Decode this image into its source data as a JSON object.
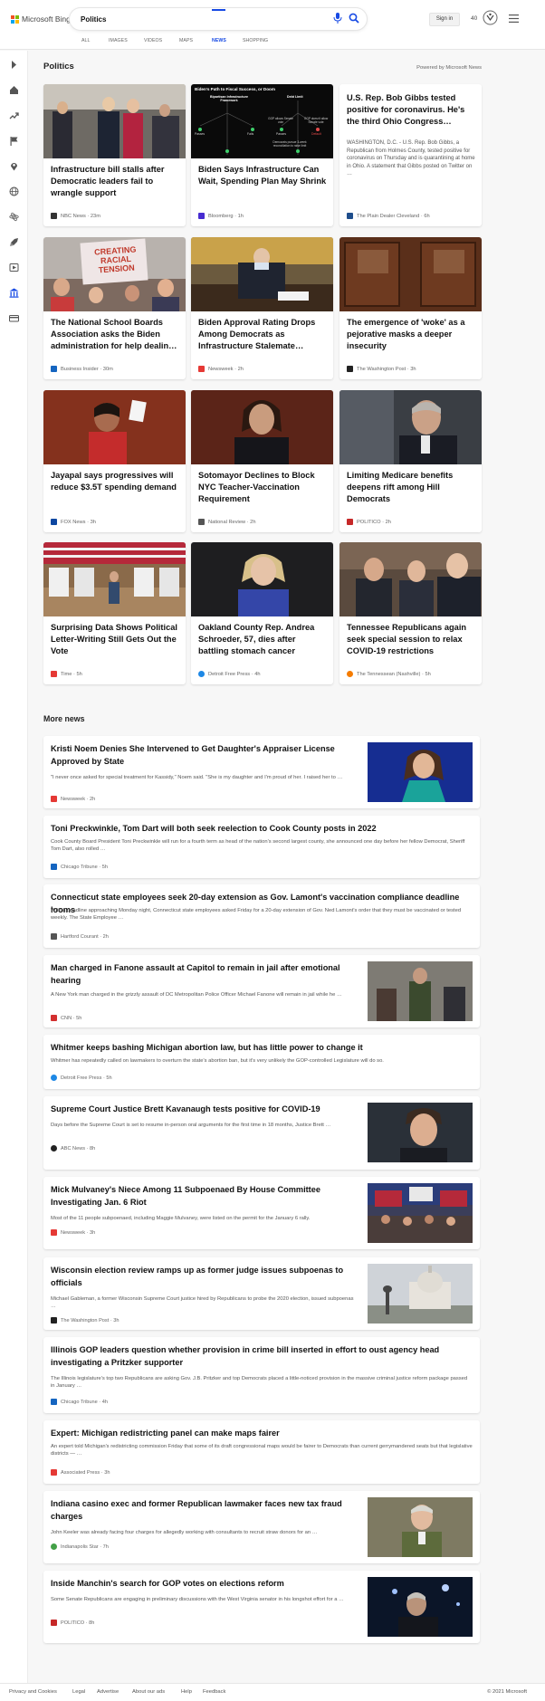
{
  "header": {
    "brand": "Microsoft Bing",
    "search_value": "Politics",
    "signin_label": "Sign in",
    "points": "40",
    "tabs": [
      {
        "label": "ALL"
      },
      {
        "label": "IMAGES"
      },
      {
        "label": "VIDEOS"
      },
      {
        "label": "MAPS"
      },
      {
        "label": "NEWS"
      },
      {
        "label": "SHOPPING"
      }
    ]
  },
  "sidebar": {
    "icons": [
      "expand-icon",
      "home-icon",
      "trending-icon",
      "flag-icon",
      "location-icon",
      "globe-icon",
      "science-icon",
      "rocket-icon",
      "entertainment-icon",
      "politics-icon",
      "money-icon"
    ]
  },
  "main": {
    "section_title": "Politics",
    "powered_by": "Powered by Microsoft News",
    "more_news_title": "More news"
  },
  "colors": {
    "accent": "#174ae4",
    "page_bg": "#f7f7f7"
  },
  "cards": [
    {
      "title": "Infrastructure bill stalls after Democratic leaders fail to wrangle support",
      "source": "NBC News",
      "time": "23m",
      "source_color": "#333333",
      "image": "pelosi-biden-photo"
    },
    {
      "title": "Biden Says Infrastructure Can Wait, Spending Plan May Shrink",
      "source": "Bloomberg",
      "time": "1h",
      "source_color": "#472cd1",
      "image": "infrastructure-diagram",
      "diagram": {
        "heading": "Biden's Path to Fiscal Success, or Doom",
        "nodes": [
          "Bipartisan Infrastructure Framework",
          "Debt Limit",
          "Passes",
          "Fails",
          "GOP allows Senate vote",
          "Passes",
          "GOP doesn't allow Senate vote",
          "Default",
          "Democrats pursue 3-week reconciliation to raise limit"
        ]
      }
    },
    {
      "title": "U.S. Rep. Bob Gibbs tested positive for coronavirus. He's the third Ohio Congress…",
      "source": "The Plain Dealer Cleveland",
      "time": "6h",
      "source_color": "#1f4e8c",
      "snippet": "WASHINGTON, D.C. - U.S. Rep. Bob Gibbs, a Republican from Holmes County, tested positive for coronavirus on Thursday and is quarantining at home in Ohio. A statement that Gibbs posted on Twitter on …"
    },
    {
      "title": "The National School Boards Association asks the Biden administration for help dealin…",
      "source": "Business Insider",
      "time": "30m",
      "source_color": "#1565c0",
      "image": "protest-sign-photo",
      "sign_text": "CREATING RACIAL TENSION"
    },
    {
      "title": "Biden Approval Rating Drops Among Democrats as Infrastructure Stalemate…",
      "source": "Newsweek",
      "time": "2h",
      "source_color": "#e53935",
      "image": "biden-desk-photo"
    },
    {
      "title": "The emergence of 'woke' as a pejorative masks a deeper insecurity",
      "source": "The Washington Post",
      "time": "3h",
      "source_color": "#222222",
      "image": "wood-panel-photo"
    },
    {
      "title": "Jayapal says progressives will reduce $3.5T spending demand",
      "source": "FOX News",
      "time": "3h",
      "source_color": "#0d47a1",
      "image": "jayapal-photo"
    },
    {
      "title": "Sotomayor Declines to Block NYC Teacher-Vaccination Requirement",
      "source": "National Review",
      "time": "2h",
      "source_color": "#555555",
      "image": "sotomayor-photo"
    },
    {
      "title": "Limiting Medicare benefits deepens rift among Hill Democrats",
      "source": "POLITICO",
      "time": "2h",
      "source_color": "#c62828",
      "image": "manchin-photo"
    },
    {
      "title": "Surprising Data Shows Political Letter-Writing Still Gets Out the Vote",
      "source": "Time",
      "time": "5h",
      "source_color": "#e53935",
      "image": "voting-booths-photo"
    },
    {
      "title": "Oakland County Rep. Andrea Schroeder, 57, dies after battling stomach cancer",
      "source": "Detroit Free Press",
      "time": "4h",
      "source_color": "#1e88e5",
      "image": "schroeder-photo"
    },
    {
      "title": "Tennessee Republicans again seek special session to relax COVID-19 restrictions",
      "source": "The Tennessean (Nashville)",
      "time": "5h",
      "source_color": "#f57c00",
      "image": "tn-politicians-photo"
    }
  ],
  "more_news": [
    {
      "title": "Kristi Noem Denies She Intervened to Get Daughter's Appraiser License Approved by State",
      "snippet": "\"I never once asked for special treatment for Kassidy,\" Noem said. \"She is my daughter and I'm proud of her. I raised her to …",
      "source": "Newsweek",
      "time": "2h",
      "source_color": "#e53935",
      "thumb": "noem-photo"
    },
    {
      "title": "Toni Preckwinkle, Tom Dart will both seek reelection to Cook County posts in 2022",
      "snippet": "Cook County Board President Toni Preckwinkle will run for a fourth term as head of the nation's second largest county, she announced one day before her fellow Democrat, Sheriff Tom Dart, also rolled …",
      "source": "Chicago Tribune",
      "time": "5h",
      "source_color": "#1565c0"
    },
    {
      "title": "Connecticut state employees seek 20-day extension as Gov. Lamont's vaccination compliance deadline looms",
      "snippet": "With a deadline approaching Monday night, Connecticut state employees asked Friday for a 20-day extension of Gov. Ned Lamont's order that they must be vaccinated or tested weekly. The State Employee …",
      "source": "Hartford Courant",
      "time": "2h",
      "source_color": "#555555"
    },
    {
      "title": "Man charged in Fanone assault at Capitol to remain in jail after emotional hearing",
      "snippet": "A New York man charged in the grizzly assault of DC Metropolitan Police Officer Michael Fanone will remain in jail while he …",
      "source": "CNN",
      "time": "5h",
      "source_color": "#d32f2f",
      "thumb": "capitol-riot-photo"
    },
    {
      "title": "Whitmer keeps bashing Michigan abortion law, but has little power to change it",
      "snippet": "Whitmer has repeatedly called on lawmakers to overturn the state's abortion ban, but it's very unlikely the GOP-controlled Legislature will do so.",
      "source": "Detroit Free Press",
      "time": "5h",
      "source_color": "#1e88e5"
    },
    {
      "title": "Supreme Court Justice Brett Kavanaugh tests positive for COVID-19",
      "snippet": "Days before the Supreme Court is set to resume in-person oral arguments for the first time in 18 months, Justice Brett …",
      "source": "ABC News",
      "time": "8h",
      "source_color": "#222222",
      "thumb": "kavanaugh-photo"
    },
    {
      "title": "Mick Mulvaney's Niece Among 11 Subpoenaed By House Committee Investigating Jan. 6 Riot",
      "snippet": "Most of the 11 people subpoenaed, including Maggie Mulvaney, were listed on the permit for the January 6 rally.",
      "source": "Newsweek",
      "time": "3h",
      "source_color": "#e53935",
      "thumb": "rally-photo"
    },
    {
      "title": "Wisconsin election review ramps up as former judge issues subpoenas to officials",
      "snippet": "Michael Gableman, a former Wisconsin Supreme Court justice hired by Republicans to probe the 2020 election, issued subpoenas …",
      "source": "The Washington Post",
      "time": "3h",
      "source_color": "#222222",
      "thumb": "capitol-building-photo"
    },
    {
      "title": "Illinois GOP leaders question whether provision in crime bill inserted in effort to oust agency head investigating a Pritzker supporter",
      "snippet": "The Illinois legislature's top two Republicans are asking Gov. J.B. Pritzker and top Democrats placed a little-noticed provision in the massive criminal justice reform package passed in January …",
      "source": "Chicago Tribune",
      "time": "4h",
      "source_color": "#1565c0"
    },
    {
      "title": "Expert: Michigan redistricting panel can make maps fairer",
      "snippet": "An expert told Michigan's redistricting commission Friday that some of its draft congressional maps would be fairer to Democrats than current gerrymandered seats but that legislative districts — …",
      "source": "Associated Press",
      "time": "3h",
      "source_color": "#e53935"
    },
    {
      "title": "Indiana casino exec and former Republican lawmaker faces new tax fraud charges",
      "snippet": "John Keeler was already facing four charges for allegedly working with consultants to recruit straw donors for an …",
      "source": "Indianapolis Star",
      "time": "7h",
      "source_color": "#43a047",
      "thumb": "keeler-photo"
    },
    {
      "title": "Inside Manchin's search for GOP votes on elections reform",
      "snippet": "Some Senate Republicans are engaging in preliminary discussions with the West Virginia senator in his longshot effort for a …",
      "source": "POLITICO",
      "time": "8h",
      "source_color": "#c62828",
      "thumb": "manchin-press-photo"
    }
  ],
  "footer": {
    "links": [
      "Privacy and Cookies",
      "Legal",
      "Advertise",
      "About our ads",
      "Help",
      "Feedback"
    ],
    "copyright": "© 2021 Microsoft"
  }
}
